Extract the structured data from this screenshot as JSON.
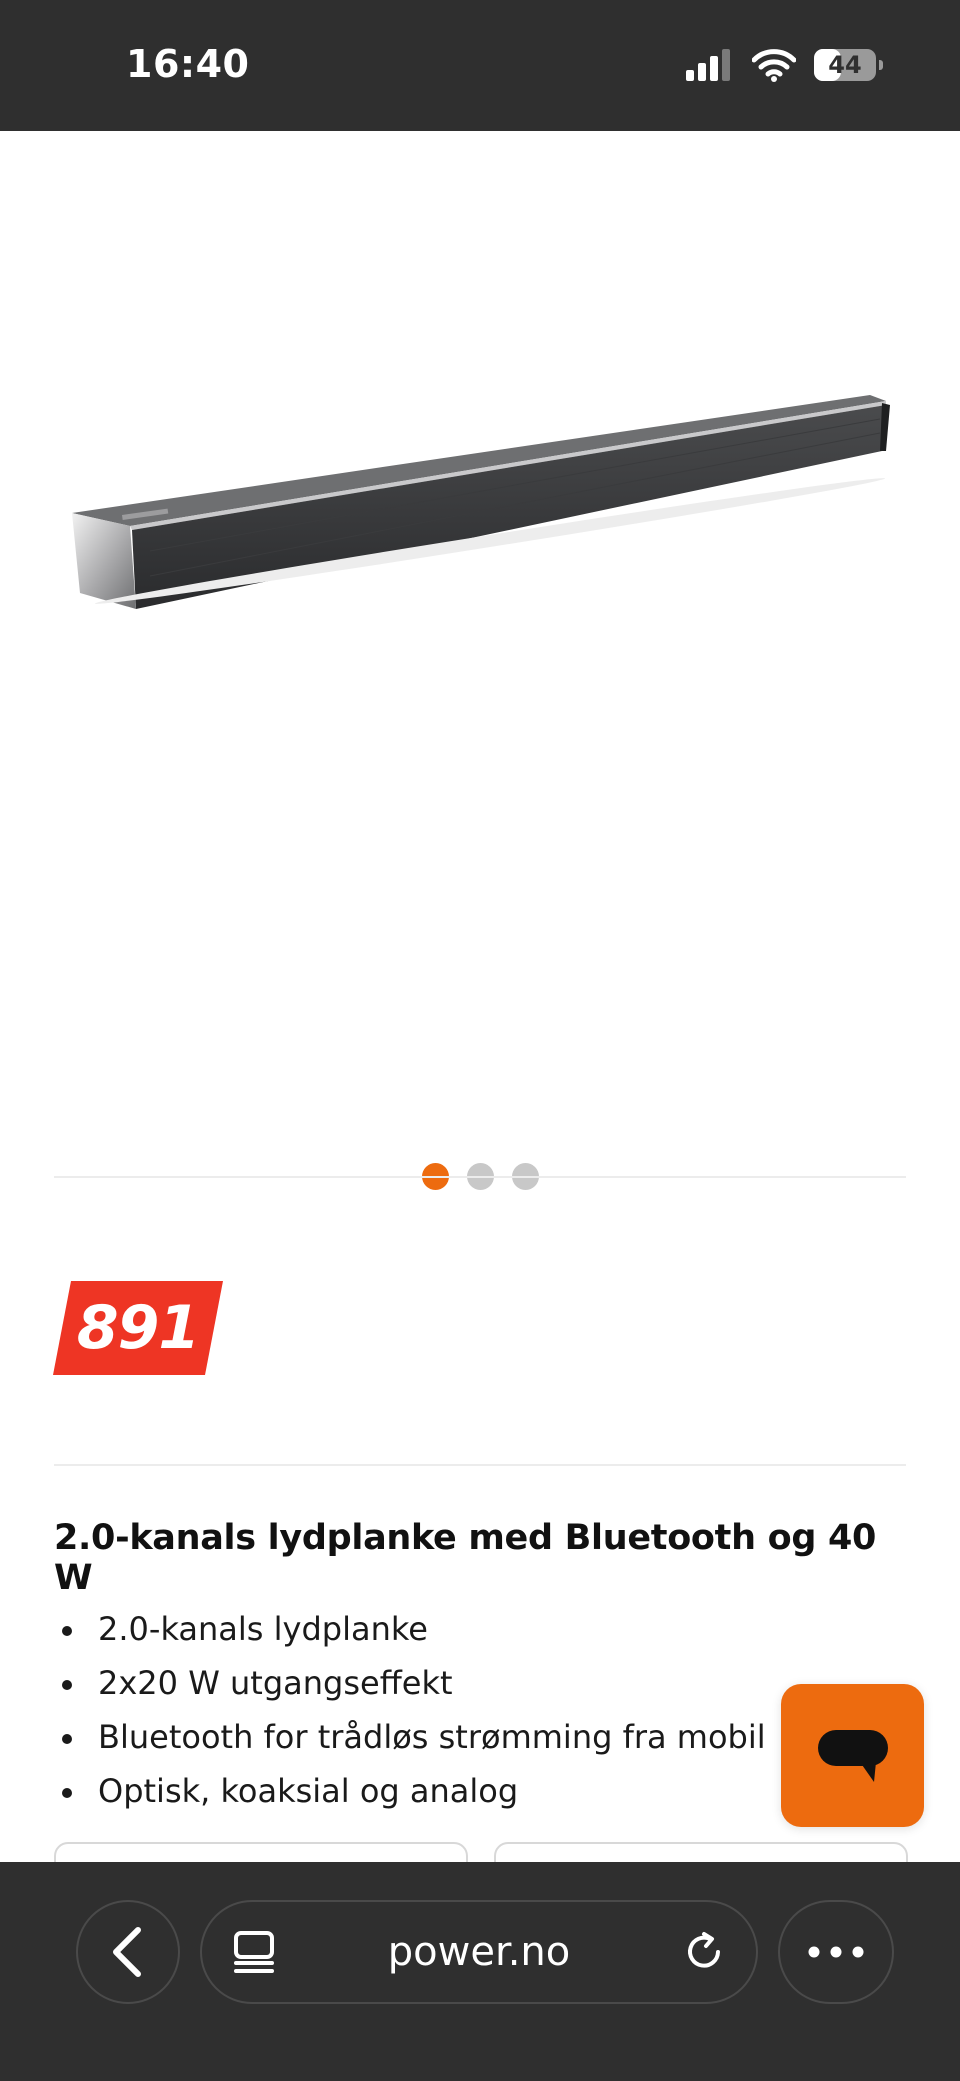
{
  "status_bar": {
    "time": "16:40",
    "battery_level": "44",
    "battery_fraction": 0.44
  },
  "gallery": {
    "image_icon": "soundbar-image",
    "slide_count": 3,
    "active_slide": 1,
    "accent_color": "#ed6b0f"
  },
  "price": {
    "value": "891",
    "tag_color": "#ee3524"
  },
  "product": {
    "title": "2.0-kanals lydplanke med Bluetooth og 40 W",
    "features": [
      "2.0-kanals lydplanke",
      "2x20 W utgangseffekt",
      "Bluetooth for trådløs strømming fra mobil",
      "Optisk, koaksial og analog"
    ]
  },
  "chat": {
    "icon": "chat-bubble-icon",
    "color": "#ed6b0f"
  },
  "browser": {
    "url": "power.no",
    "back_icon": "chevron-left-icon",
    "tabs_icon": "tab-overview-icon",
    "reload_icon": "reload-icon",
    "more_icon": "more-dots-icon"
  }
}
